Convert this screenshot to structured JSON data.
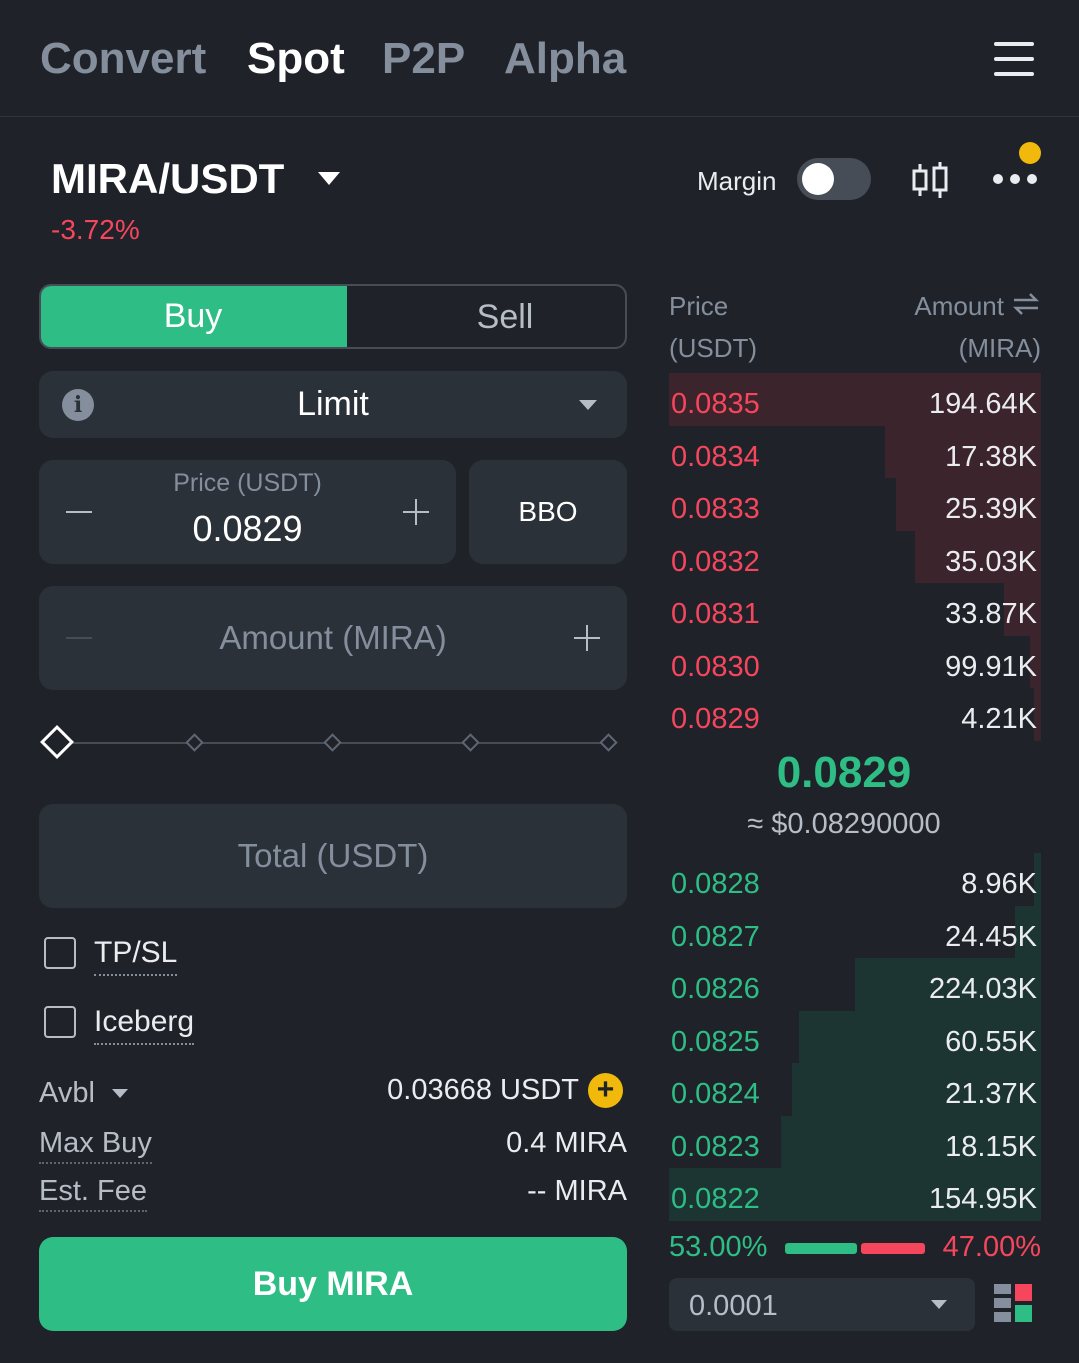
{
  "nav": {
    "tabs": [
      "Convert",
      "Spot",
      "P2P",
      "Alpha"
    ],
    "active": "Spot"
  },
  "pair": {
    "name": "MIRA/USDT",
    "change": "-3.72%",
    "margin_label": "Margin",
    "margin_enabled": false
  },
  "order_form": {
    "buy_label": "Buy",
    "sell_label": "Sell",
    "order_type": "Limit",
    "price_label": "Price (USDT)",
    "price_value": "0.0829",
    "bbo_label": "BBO",
    "amount_placeholder": "Amount (MIRA)",
    "slider_percent": 0,
    "total_placeholder": "Total (USDT)",
    "tpsl_label": "TP/SL",
    "iceberg_label": "Iceberg",
    "avbl_label": "Avbl",
    "avbl_value": "0.03668 USDT",
    "max_buy_label": "Max Buy",
    "max_buy_value": "0.4 MIRA",
    "fee_label": "Est. Fee",
    "fee_value": "-- MIRA",
    "submit_label": "Buy MIRA"
  },
  "orderbook": {
    "price_header": "Price",
    "price_unit": "(USDT)",
    "amount_header": "Amount",
    "amount_unit": "(MIRA)",
    "asks": [
      {
        "price": "0.0835",
        "amount": "194.64K",
        "depth": 1.0
      },
      {
        "price": "0.0834",
        "amount": "17.38K",
        "depth": 0.42
      },
      {
        "price": "0.0833",
        "amount": "25.39K",
        "depth": 0.39
      },
      {
        "price": "0.0832",
        "amount": "35.03K",
        "depth": 0.34
      },
      {
        "price": "0.0831",
        "amount": "33.87K",
        "depth": 0.1
      },
      {
        "price": "0.0830",
        "amount": "99.91K",
        "depth": 0.03
      },
      {
        "price": "0.0829",
        "amount": "4.21K",
        "depth": 0.02
      }
    ],
    "mid_price": "0.0829",
    "mid_usd": "≈ $0.08290000",
    "bids": [
      {
        "price": "0.0828",
        "amount": "8.96K",
        "depth": 0.02
      },
      {
        "price": "0.0827",
        "amount": "24.45K",
        "depth": 0.07
      },
      {
        "price": "0.0826",
        "amount": "224.03K",
        "depth": 0.5
      },
      {
        "price": "0.0825",
        "amount": "60.55K",
        "depth": 0.65
      },
      {
        "price": "0.0824",
        "amount": "21.37K",
        "depth": 0.67
      },
      {
        "price": "0.0823",
        "amount": "18.15K",
        "depth": 0.7
      },
      {
        "price": "0.0822",
        "amount": "154.95K",
        "depth": 1.0
      }
    ],
    "buy_ratio": "53.00%",
    "sell_ratio": "47.00%",
    "precision": "0.0001"
  },
  "colors": {
    "buy": "#2ebd85",
    "sell": "#f6465d",
    "accent": "#f0b90b",
    "bg": "#1f2329",
    "field": "#2b3139"
  }
}
